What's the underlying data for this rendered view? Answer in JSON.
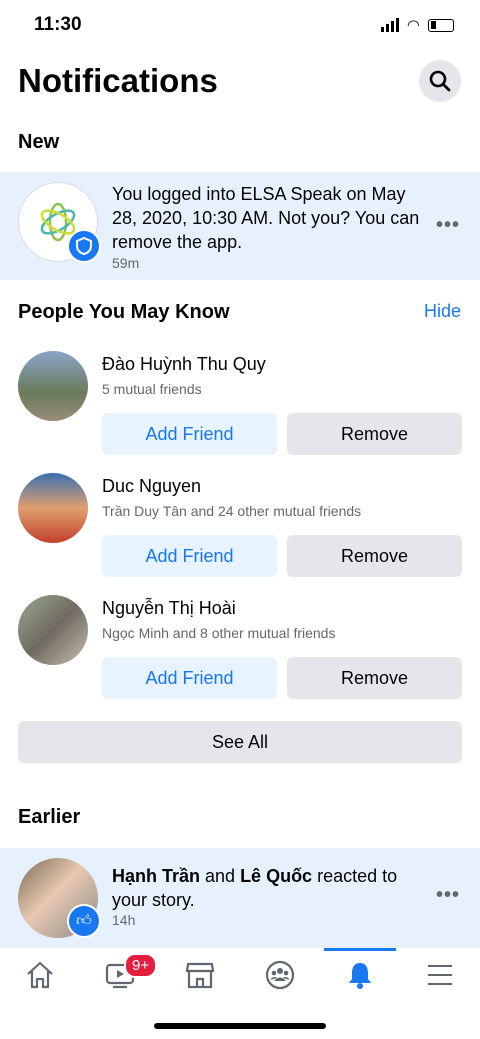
{
  "status_bar": {
    "time": "11:30"
  },
  "header": {
    "title": "Notifications"
  },
  "sections": {
    "new": "New",
    "pymk": "People You May Know",
    "hide": "Hide",
    "earlier": "Earlier",
    "see_all": "See All"
  },
  "notifications": [
    {
      "text": "You logged into ELSA Speak on May 28, 2020, 10:30 AM. Not you? You can remove the app.",
      "time": "59m"
    },
    {
      "name1": "Hạnh Trần",
      "and": " and ",
      "name2": "Lê Quốc",
      "rest": " reacted to your story.",
      "time": "14h"
    }
  ],
  "people": [
    {
      "name": "Đào Huỳnh Thu Quy",
      "mutual": "5 mutual friends",
      "add": "Add Friend",
      "remove": "Remove"
    },
    {
      "name": "Duc Nguyen",
      "mutual": "Trần Duy Tân and 24 other mutual friends",
      "add": "Add Friend",
      "remove": "Remove"
    },
    {
      "name": "Nguyễn Thị Hoài",
      "mutual": "Ngọc Minh and 8 other mutual friends",
      "add": "Add Friend",
      "remove": "Remove"
    }
  ],
  "nav": {
    "watch_badge": "9+",
    "active": "notifications",
    "accent": "#1877f2"
  }
}
